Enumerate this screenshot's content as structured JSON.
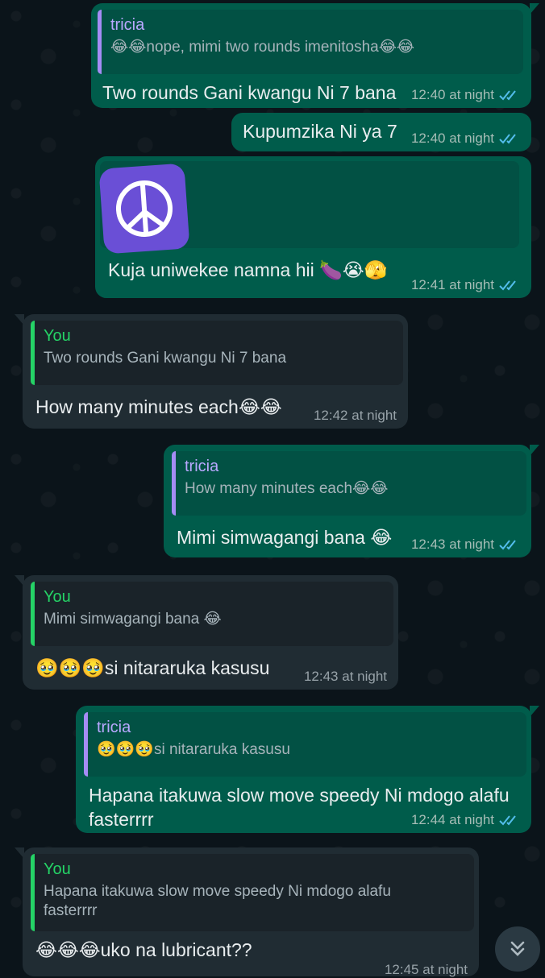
{
  "messages": [
    {
      "sender": "out",
      "quote_author": "tricia",
      "quote_text": "😂😂nope,  mimi two rounds imenitosha😂😂",
      "text": "Two rounds Gani kwangu Ni 7 bana",
      "time": "12:40 at night"
    },
    {
      "sender": "out",
      "text": "Kupumzika Ni ya 7",
      "time": "12:40 at night"
    },
    {
      "sender": "out",
      "sticker": "peace-symbol",
      "text": "Kuja uniwekee namna hii 🍆😭🫣",
      "time": "12:41 at night"
    },
    {
      "sender": "in",
      "quote_author": "You",
      "quote_text": "Two rounds Gani kwangu Ni 7 bana",
      "text": "How many minutes each😂😂",
      "time": "12:42 at night"
    },
    {
      "sender": "out",
      "quote_author": "tricia",
      "quote_text": "How many minutes each😂😂",
      "text": "Mimi simwagangi bana 😂",
      "time": "12:43 at night"
    },
    {
      "sender": "in",
      "quote_author": "You",
      "quote_text": "Mimi simwagangi bana 😂",
      "text": "🥹🥹🥹si nitararuka kasusu",
      "time": "12:43 at night"
    },
    {
      "sender": "out",
      "quote_author": "tricia",
      "quote_text": "🥹🥹🥹si nitararuka kasusu",
      "text_line1": "Hapana itakuwa slow move speedy Ni mdogo alafu",
      "text_line2": "fasterrrr",
      "time": "12:44 at night"
    },
    {
      "sender": "in",
      "quote_author": "You",
      "quote_text_line1": "Hapana itakuwa slow move speedy Ni mdogo alafu",
      "quote_text_line2": "fasterrrr",
      "text": "😂😂😂uko na lubricant??",
      "time": "12:45 at night"
    }
  ],
  "colors": {
    "outgoing": "#005c4b",
    "incoming": "#202c33",
    "read_ticks": "#53bdeb"
  },
  "icons": {
    "read_receipt": "double-check-icon",
    "scroll_down": "chevron-double-down-icon"
  }
}
